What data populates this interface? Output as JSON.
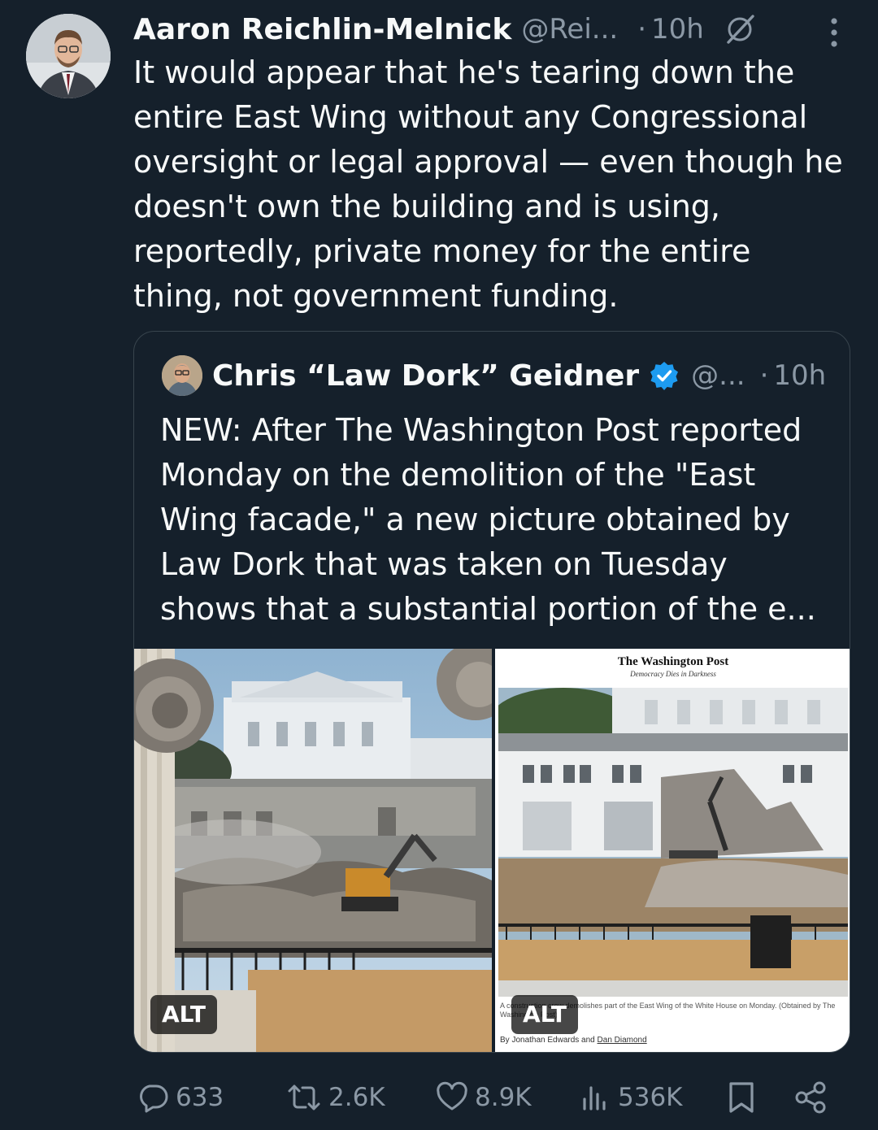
{
  "tweet": {
    "author_name": "Aaron Reichlin-Melnick",
    "handle": "@Rei...",
    "separator": "·",
    "time": "10h",
    "text": "It would appear that he's tearing down the entire East Wing without any Congressional oversight or legal approval — even though he doesn't own the building and is using, reportedly, private money for the entire thing, not government funding."
  },
  "quote": {
    "author_name": "Chris “Law Dork” Geidner",
    "handle": "@...",
    "separator": "·",
    "time": "10h",
    "text": "NEW: After The Washington Post reported Monday on the demolition of the \"East Wing facade,\" a new picture obtained by Law Dork that was taken on Tuesday shows that a substantial portion of the e...",
    "media": {
      "alt_left": "ALT",
      "alt_right": "ALT",
      "wp_masthead": "The Washington Post",
      "wp_tagline": "Democracy Dies in Darkness",
      "wp_caption": "A construction crew demolishes part of the East Wing of the White House on Monday. (Obtained by The Washington Post)",
      "wp_byline_prefix": "By Jonathan Edwards and ",
      "wp_byline_link": "Dan Diamond"
    }
  },
  "actions": {
    "replies": "633",
    "reposts": "2.6K",
    "likes": "8.9K",
    "views": "536K"
  },
  "colors": {
    "background": "#15202b",
    "text": "#f7f9f9",
    "muted": "#8b98a5",
    "border": "#38444d",
    "verified": "#1d9bf0"
  },
  "icons": [
    "grok-icon",
    "more-icon",
    "verified-badge-icon",
    "reply-icon",
    "repost-icon",
    "like-icon",
    "views-icon",
    "bookmark-icon",
    "share-icon"
  ]
}
